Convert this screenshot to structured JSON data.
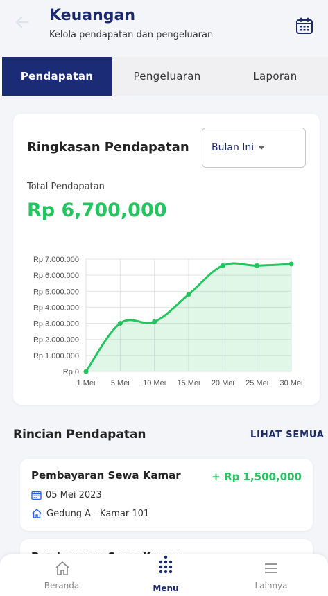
{
  "header": {
    "title": "Keuangan",
    "subtitle": "Kelola pendapatan dan pengeluaran"
  },
  "tabs": [
    {
      "label": "Pendapatan",
      "active": true
    },
    {
      "label": "Pengeluaran",
      "active": false
    },
    {
      "label": "Laporan",
      "active": false
    }
  ],
  "summary": {
    "title": "Ringkasan Pendapatan",
    "period": "Bulan Ini",
    "total_label": "Total Pendapatan",
    "total_value": "Rp 6,700,000"
  },
  "chart_data": {
    "type": "line",
    "x": [
      "1 Mei",
      "5 Mei",
      "10 Mei",
      "15 Mei",
      "20 Mei",
      "25 Mei",
      "30 Mei"
    ],
    "series": [
      {
        "values": [
          0,
          3000000,
          3100000,
          4800000,
          6600000,
          6600000,
          6700000
        ]
      }
    ],
    "y_ticks": [
      "Rp 0",
      "Rp 1.000.000",
      "Rp 2.000.000",
      "Rp 3.000.000",
      "Rp 4.000.000",
      "Rp 5.000.000",
      "Rp 6.000.000",
      "Rp 7.000.000"
    ],
    "ylim": [
      0,
      7000000
    ],
    "grid": true,
    "fill": true,
    "color": "#22c55e"
  },
  "details": {
    "title": "Rincian Pendapatan",
    "see_all": "LIHAT SEMUA",
    "items": [
      {
        "title": "Pembayaran Sewa Kamar",
        "amount": "+ Rp 1,500,000",
        "date": "05 Mei 2023",
        "location": "Gedung A - Kamar 101"
      },
      {
        "title": "Pembayaran Sewa Kamar",
        "amount": "",
        "date": "",
        "location": ""
      }
    ]
  },
  "nav": [
    {
      "label": "Beranda",
      "icon": "home-icon"
    },
    {
      "label": "Menu",
      "icon": "grid-dots-icon"
    },
    {
      "label": "Lainnya",
      "icon": "hamburger-icon"
    }
  ],
  "colors": {
    "brand": "#1b2b75",
    "positive": "#22c55e",
    "accent_icon": "#2563eb"
  }
}
